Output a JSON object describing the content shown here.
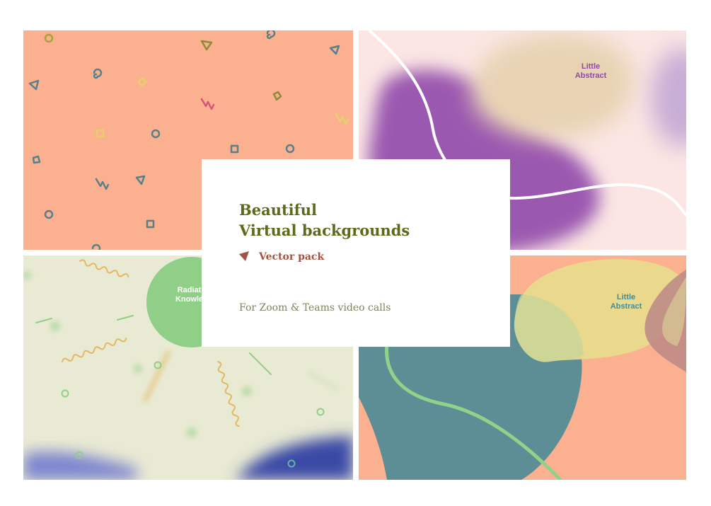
{
  "card": {
    "title_line1": "Beautiful",
    "title_line2": "Virtual backgrounds",
    "subtitle": "Vector pack",
    "tagline": "For Zoom & Teams video calls"
  },
  "panels": {
    "top_right_label": "Little\nAbstract",
    "bottom_left_label": "Radiat\nKnowle",
    "bottom_right_label": "Little\nAbstract"
  },
  "colors": {
    "title": "#5c6a1c",
    "subtitle": "#a25440",
    "tagline": "#7c8560",
    "peach": "#fbb190",
    "purple": "#9b59b0",
    "green": "#8fcf87",
    "teal": "#5d8e96",
    "yellow": "#e8db8c",
    "navy": "#3b48a6"
  },
  "icons": {
    "subtitle_marker": "triangle-icon"
  }
}
